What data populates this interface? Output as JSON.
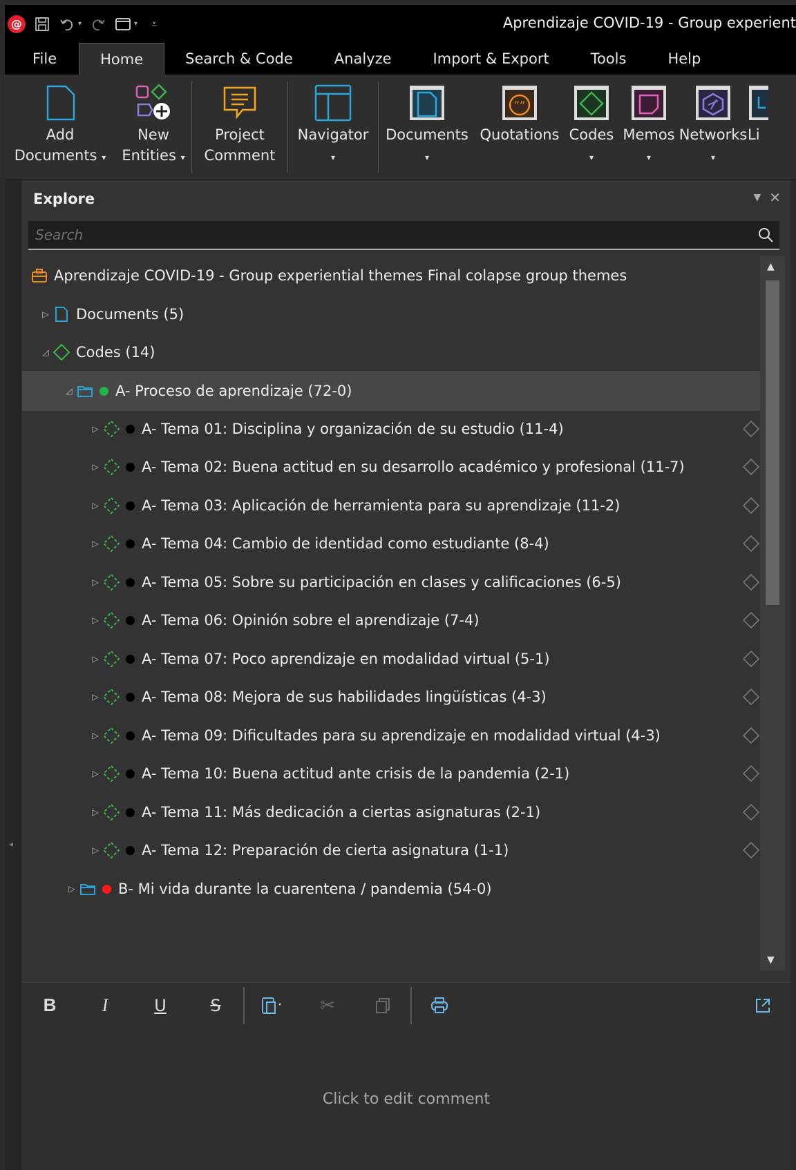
{
  "window": {
    "title": "Aprendizaje COVID-19 - Group experient"
  },
  "ribbon_tabs": [
    "File",
    "Home",
    "Search & Code",
    "Analyze",
    "Import & Export",
    "Tools",
    "Help"
  ],
  "active_tab": "Home",
  "ribbon": {
    "add_documents": [
      "Add",
      "Documents"
    ],
    "new_entities": [
      "New",
      "Entities"
    ],
    "project_comment": [
      "Project",
      "Comment"
    ],
    "navigator": "Navigator",
    "documents": "Documents",
    "quotations": "Quotations",
    "codes": "Codes",
    "memos": "Memos",
    "networks": "Networks",
    "links": "Li"
  },
  "explore": {
    "title": "Explore",
    "search_placeholder": "Search",
    "project": "Aprendizaje COVID-19 - Group experiential themes Final colapse group themes",
    "documents": "Documents (5)",
    "codes": "Codes (14)",
    "group_a": "A- Proceso de aprendizaje (72-0)",
    "group_b": "B- Mi vida durante la cuarentena / pandemia (54-0)",
    "themes": [
      "A- Tema 01: Disciplina y organización de su estudio (11-4)",
      "A- Tema 02: Buena actitud en su desarrollo académico y profesional (11-7)",
      "A- Tema 03: Aplicación de herramienta para su aprendizaje (11-2)",
      "A- Tema 04: Cambio de identidad como estudiante (8-4)",
      "A- Tema 05: Sobre su participación en clases y calificaciones (6-5)",
      "A- Tema 06: Opinión sobre el aprendizaje (7-4)",
      "A- Tema 07: Poco aprendizaje en modalidad virtual (5-1)",
      "A- Tema 08: Mejora de sus habilidades lingüísticas (4-3)",
      "A- Tema 09: Dificultades para su aprendizaje en modalidad virtual (4-3)",
      "A- Tema 10: Buena actitud ante crisis de la pandemia (2-1)",
      "A- Tema 11: Más dedicación a ciertas asignaturas (2-1)",
      "A- Tema 12: Preparación de cierta asignatura (1-1)"
    ]
  },
  "comment": {
    "placeholder": "Click to edit comment"
  },
  "colors": {
    "group_a_dot": "#22b14c",
    "group_b_dot": "#ff1a1a",
    "code_icon": "#3cb44b",
    "doc_icon": "#2f9fd4"
  }
}
